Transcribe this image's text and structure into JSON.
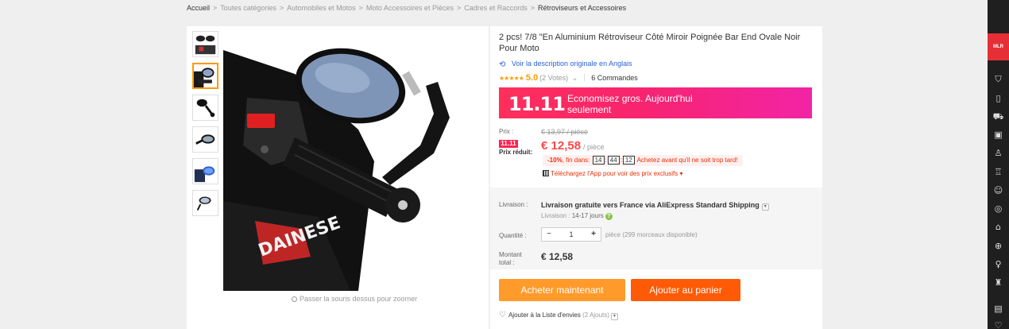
{
  "breadcrumb": [
    "Accueil",
    "Toutes catégories",
    "Automobiles et Motos",
    "Moto Accessoires et Pièces",
    "Cadres et Raccords",
    "Rétroviseurs et Accessoires"
  ],
  "product": {
    "title": "2 pcs! 7/8 \"En Aluminium Rétroviseur Côté Miroir Poignée Bar End Ovale Noir Pour Moto",
    "translate_link": "Voir la description originale en Anglais",
    "stars": "★★★★★",
    "score": "5.0",
    "votes": "(2 Votes)",
    "orders": "6 Commandes",
    "zoom_hint": "Passer la souris dessus pour zoomer"
  },
  "promo": {
    "badge": "11.11",
    "text": "Economisez gros. Aujourd'hui seulement"
  },
  "price": {
    "label": "Prix :",
    "old": "€ 13,97 / pièce",
    "badge": "11.11",
    "reduced_label": "Prix réduit:",
    "new": "€ 12,58",
    "unit": "/ pièce",
    "discount_pct": "-10%",
    "ends_in": ", fin dans:",
    "timer": [
      "14",
      "44",
      "12"
    ],
    "urgency": "Achetez avant qu'il ne soit trop tard!",
    "app_promo": "Téléchargez l'App pour voir des prix exclusifs ▾"
  },
  "shipping": {
    "label": "Livraison :",
    "value": "Livraison gratuite vers France via AliExpress Standard Shipping",
    "time_label": "Livraison :",
    "time_value": "14-17 jours"
  },
  "quantity": {
    "label": "Quantité :",
    "value": "1",
    "minus": "−",
    "plus": "+",
    "available": "pièce (299 morceaux disponible)"
  },
  "total": {
    "label_line1": "Montant",
    "label_line2": "total :",
    "value": "€ 12,58"
  },
  "actions": {
    "buy_now": "Acheter maintenant",
    "add_to_cart": "Ajouter au panier",
    "wishlist": "Ajouter à la Liste d'envies",
    "wishlist_count": "(2 Ajouts)"
  },
  "sidebar": {
    "logo": "MLR",
    "icons": [
      "shirt-icon",
      "phone-icon",
      "car-icon",
      "camera-icon",
      "shoe-icon",
      "bottle-icon",
      "baby-icon",
      "ball-icon",
      "bag-icon",
      "sport-icon",
      "bulb-icon",
      "toy-icon",
      "wallet-icon",
      "heart-icon"
    ]
  },
  "colors": {
    "accent_orange": "#ff9a2b",
    "cart_orange": "#ff5a06",
    "price_red": "#ff4747",
    "promo_pink": "#f7246f",
    "link_blue": "#2962d6"
  }
}
